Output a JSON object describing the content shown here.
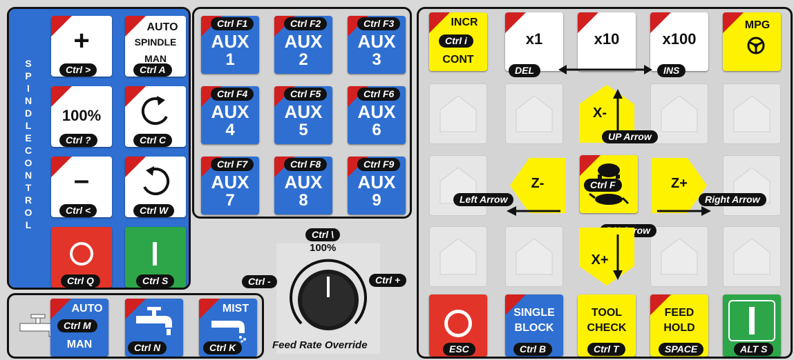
{
  "spindle": {
    "vertical_label": [
      "S",
      "P",
      "I",
      "N",
      "D",
      "L",
      "E",
      " ",
      "C",
      "O",
      "N",
      "T",
      "R",
      "O",
      "L"
    ],
    "keys": {
      "plus": {
        "symbol": "+",
        "shortcut": "Ctrl >"
      },
      "auto": {
        "l1": "AUTO",
        "l2": "SPINDLE",
        "l3": "MAN",
        "shortcut": "Ctrl A"
      },
      "pct100": {
        "label": "100%",
        "shortcut": "Ctrl ?"
      },
      "cw": {
        "shortcut": "Ctrl C"
      },
      "minus": {
        "symbol": "–",
        "shortcut": "Ctrl <"
      },
      "ccw": {
        "shortcut": "Ctrl W"
      },
      "stop": {
        "shortcut": "Ctrl Q"
      },
      "start": {
        "shortcut": "Ctrl S"
      }
    }
  },
  "aux": [
    {
      "shortcut": "Ctrl F1",
      "label": "AUX",
      "num": "1"
    },
    {
      "shortcut": "Ctrl F2",
      "label": "AUX",
      "num": "2"
    },
    {
      "shortcut": "Ctrl F3",
      "label": "AUX",
      "num": "3"
    },
    {
      "shortcut": "Ctrl F4",
      "label": "AUX",
      "num": "4"
    },
    {
      "shortcut": "Ctrl F5",
      "label": "AUX",
      "num": "5"
    },
    {
      "shortcut": "Ctrl F6",
      "label": "AUX",
      "num": "6"
    },
    {
      "shortcut": "Ctrl F7",
      "label": "AUX",
      "num": "7"
    },
    {
      "shortcut": "Ctrl F8",
      "label": "AUX",
      "num": "8"
    },
    {
      "shortcut": "Ctrl F9",
      "label": "AUX",
      "num": "9"
    }
  ],
  "coolant": {
    "auto": {
      "l1": "AUTO",
      "shortcut": "Ctrl M",
      "l3": "MAN"
    },
    "flood": {
      "shortcut": "Ctrl N"
    },
    "mist": {
      "label": "MIST",
      "shortcut": "Ctrl K"
    }
  },
  "feed": {
    "top": "Ctrl \\",
    "pct": "100%",
    "minus": "Ctrl -",
    "plus": "Ctrl +",
    "caption": "Feed Rate Override"
  },
  "jog": {
    "incr": {
      "l1": "INCR",
      "shortcut": "Ctrl i",
      "l3": "CONT"
    },
    "x1": "x1",
    "x10": "x10",
    "x100": "x100",
    "mpg": "MPG",
    "del": "DEL",
    "ins": "INS",
    "xminus": "X-",
    "xplus": "X+",
    "zminus": "Z-",
    "zplus": "Z+",
    "fast": "Ctrl F",
    "up": "UP Arrow",
    "dn": "DN Arrow",
    "left": "Left Arrow",
    "right": "Right Arrow",
    "esc": "ESC",
    "single_l1": "SINGLE",
    "single_l2": "BLOCK",
    "single_sc": "Ctrl B",
    "tool_l1": "TOOL",
    "tool_l2": "CHECK",
    "tool_sc": "Ctrl T",
    "hold_l1": "FEED",
    "hold_l2": "HOLD",
    "hold_sc": "SPACE",
    "start_sc": "ALT S"
  },
  "colors": {
    "blue": "#2f6fd1",
    "yellow": "#fff200",
    "red": "#e3342a",
    "green": "#2da64a",
    "corner": "#d21f1f"
  }
}
